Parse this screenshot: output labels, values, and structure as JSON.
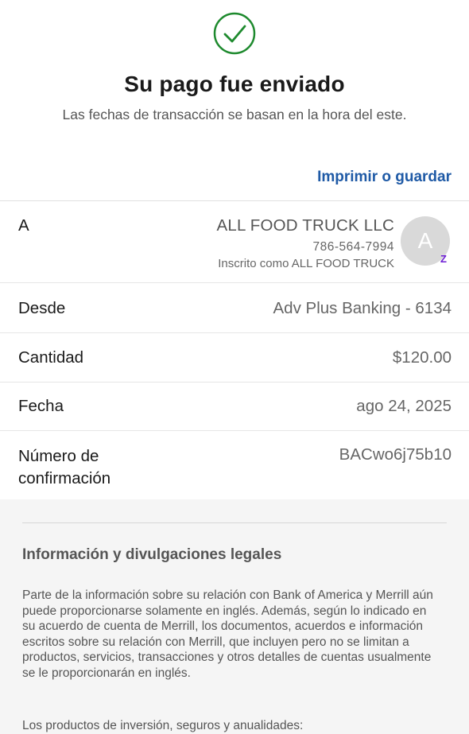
{
  "header": {
    "title": "Su pago fue enviado",
    "subtitle": "Las fechas de transacción se basan en la hora del este.",
    "print_label": "Imprimir o guardar",
    "status_icon": "check-circle-icon",
    "status_color": "#1e8a2e"
  },
  "details": {
    "to_label": "A",
    "payee_name": "ALL FOOD TRUCK LLC",
    "payee_phone": "786-564-7994",
    "payee_enrolled": "Inscrito como ALL FOOD TRUCK",
    "avatar_initial": "A",
    "zelle_badge": "Z",
    "from_label": "Desde",
    "from_value": "Adv Plus Banking - 6134",
    "amount_label": "Cantidad",
    "amount_value": "$120.00",
    "date_label": "Fecha",
    "date_value": "ago 24, 2025",
    "confirmation_label": "Número de confirmación",
    "confirmation_value": "BACwo6j75b10"
  },
  "legal": {
    "title": "Información y divulgaciones legales",
    "paragraph1": "Parte de la información sobre su relación con Bank of America y Merrill aún puede proporcionarse solamente en inglés. Además, según lo indicado en su acuerdo de cuenta de Merrill, los documentos, acuerdos e información escritos sobre su relación con Merrill, que incluyen pero no se limitan a productos, servicios, transacciones y otros detalles de cuentas usualmente se le proporcionarán en inglés.",
    "paragraph2": "Los productos de inversión, seguros y anualidades:"
  },
  "colors": {
    "accent": "#1f5aa6",
    "zelle": "#6d1ed4"
  }
}
